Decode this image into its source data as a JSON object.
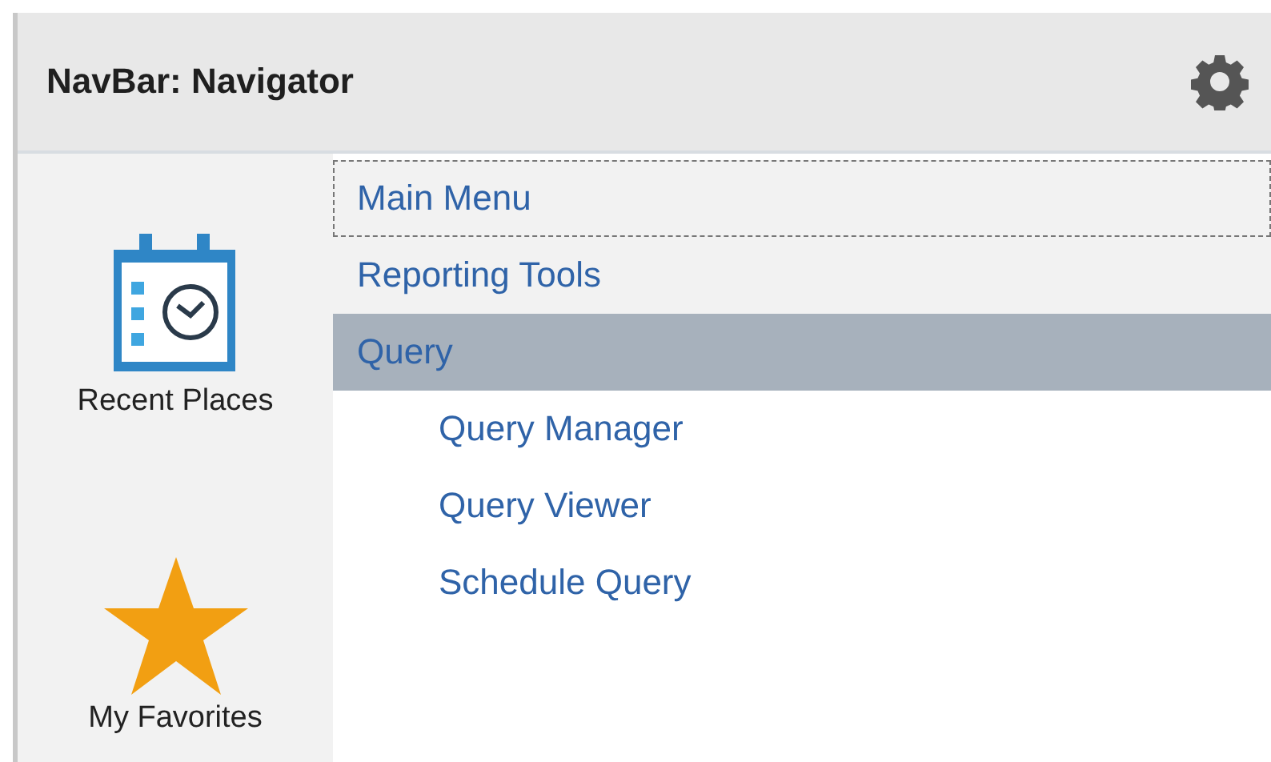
{
  "panel": {
    "title": "NavBar: Navigator"
  },
  "sidebar": {
    "items": [
      {
        "kind": "recent",
        "label": "Recent Places"
      },
      {
        "kind": "favorites",
        "label": "My Favorites"
      }
    ]
  },
  "menu": {
    "items": [
      {
        "label": "Main Menu",
        "focused": true,
        "selected": false
      },
      {
        "label": "Reporting Tools",
        "focused": false,
        "selected": false
      },
      {
        "label": "Query",
        "focused": false,
        "selected": true,
        "children": [
          {
            "label": "Query Manager"
          },
          {
            "label": "Query Viewer"
          },
          {
            "label": "Schedule Query"
          }
        ]
      }
    ]
  }
}
